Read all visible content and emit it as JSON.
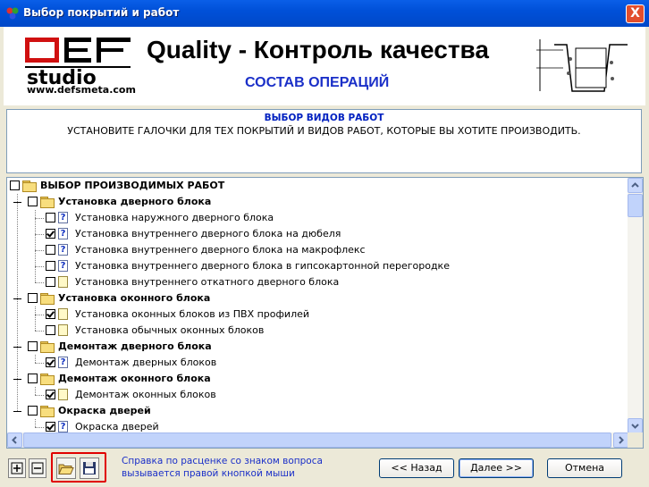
{
  "window": {
    "title": "Выбор покрытий и работ",
    "close_label": "X"
  },
  "header": {
    "logo_top": "DEF",
    "logo_bottom": "studio",
    "website": "www.defsmeta.com",
    "app_title": "Quality - Контроль качества",
    "subtitle": "СОСТАВ ОПЕРАЦИЙ"
  },
  "instructions": {
    "heading": "ВЫБОР  ВИДОВ РАБОТ",
    "text": "УСТАНОВИТЕ ГАЛОЧКИ ДЛЯ ТЕХ ПОКРЫТИЙ И ВИДОВ РАБОТ, КОТОРЫЕ ВЫ ХОТИТЕ ПРОИЗВОДИТЬ."
  },
  "tree": {
    "root": "ВЫБОР ПРОИЗВОДИМЫХ РАБОТ",
    "groups": [
      {
        "label": "Установка дверного блока",
        "items": [
          {
            "label": "Установка наружного дверного блока",
            "checked": false,
            "icon": "question-doc-icon"
          },
          {
            "label": "Установка внутреннего дверного блока на дюбеля",
            "checked": true,
            "icon": "question-doc-icon"
          },
          {
            "label": "Установка внутреннего дверного блока на макрофлекс",
            "checked": false,
            "icon": "question-doc-icon"
          },
          {
            "label": "Установка внутреннего дверного блока в гипсокартонной перегородке",
            "checked": false,
            "icon": "question-doc-icon"
          },
          {
            "label": "Установка внутреннего откатного дверного блока",
            "checked": false,
            "icon": "note-icon"
          }
        ]
      },
      {
        "label": "Установка оконного блока",
        "items": [
          {
            "label": "Установка оконных блоков из ПВХ профилей",
            "checked": true,
            "icon": "note-icon"
          },
          {
            "label": "Установка обычных оконных блоков",
            "checked": false,
            "icon": "note-icon"
          }
        ]
      },
      {
        "label": "Демонтаж дверного блока",
        "items": [
          {
            "label": "Демонтаж дверных блоков",
            "checked": true,
            "icon": "question-doc-icon"
          }
        ]
      },
      {
        "label": "Демонтаж оконного блока",
        "items": [
          {
            "label": "Демонтаж оконных блоков",
            "checked": true,
            "icon": "note-icon"
          }
        ]
      },
      {
        "label": "Окраска дверей",
        "items": [
          {
            "label": "Окраска дверей",
            "checked": true,
            "icon": "question-doc-icon"
          }
        ]
      }
    ]
  },
  "footer": {
    "help_text": "Справка по расценке со знаком вопроса вызывается правой кнопкой мыши",
    "back_label": "<< Назад",
    "next_label": "Далее >>",
    "cancel_label": "Отмена"
  },
  "colors": {
    "accent": "#1A2FC8",
    "titlebar": "#0050D8",
    "highlight": "#E00000"
  }
}
